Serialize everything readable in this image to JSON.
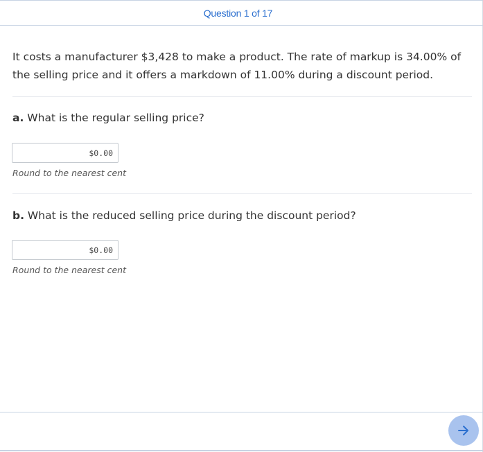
{
  "header": {
    "title": "Question 1 of 17"
  },
  "problem": {
    "text": "It costs a manufacturer $3,428 to make a product. The rate of markup is 34.00% of the selling price and it offers a markdown of 11.00% during a discount period."
  },
  "parts": [
    {
      "letter": "a.",
      "question": "What is the regular selling price?",
      "answer_value": "$0.00",
      "hint": "Round to the nearest cent"
    },
    {
      "letter": "b.",
      "question": "What is the reduced selling price during the discount period?",
      "answer_value": "$0.00",
      "hint": "Round to the nearest cent"
    }
  ],
  "footer": {
    "next_icon": "arrow-right-icon"
  }
}
